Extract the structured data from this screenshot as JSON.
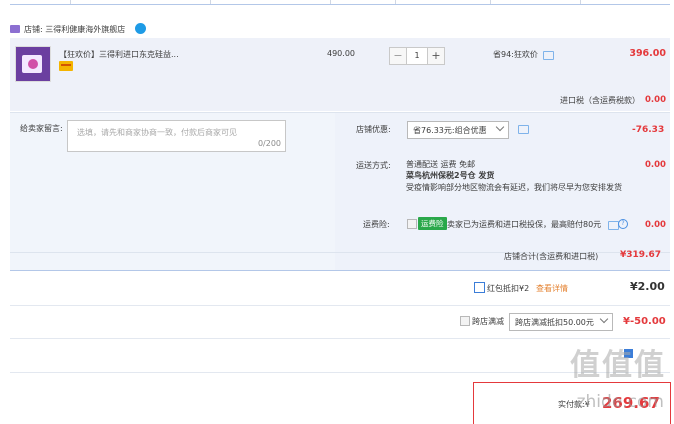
{
  "shop": {
    "name": "店铺: 三得利健康海外旗舰店"
  },
  "item": {
    "title": "【狂欢价】三得利进口东克硅益...",
    "unit_price": "490.00",
    "qty_minus": "−",
    "qty": "1",
    "qty_plus": "+",
    "promo": "省94:狂欢价",
    "subtotal": "396.00",
    "tax_label": "进口税（含运费税款）",
    "tax_value": "0.00"
  },
  "message": {
    "label": "给卖家留言:",
    "placeholder": "选填，请先和商家协商一致，付款后商家可见",
    "counter": "0/200"
  },
  "coupon": {
    "label": "店铺优惠:",
    "selected": "省76.33元:组合优惠",
    "value": "-76.33"
  },
  "shipping": {
    "label": "运送方式:",
    "line1": "普通配送 运费 免邮",
    "line2": "菜鸟杭州保税2号仓  发货",
    "line3": "受疫情影响部分地区物流会有延迟，我们将尽早为您安排发货",
    "value": "0.00"
  },
  "insurance": {
    "label": "运费险:",
    "tag": "运费险",
    "text": "卖家已为运费和进口税投保，最高赔付80元",
    "q": "?",
    "value": "0.00"
  },
  "shop_total": {
    "label": "店铺合计(含运费和进口税)",
    "value": "¥319.67"
  },
  "red_envelope": {
    "label": "红包抵扣¥2",
    "link": "查看详情",
    "value": "¥2.00"
  },
  "cross_store": {
    "label": "跨店满减",
    "selected": "跨店满减抵扣50.00元",
    "value": "¥-50.00"
  },
  "pay": {
    "label": "实付款:¥",
    "value": "269.67"
  },
  "watermark": {
    "main": "值值值",
    "sub": "zhide.com"
  }
}
